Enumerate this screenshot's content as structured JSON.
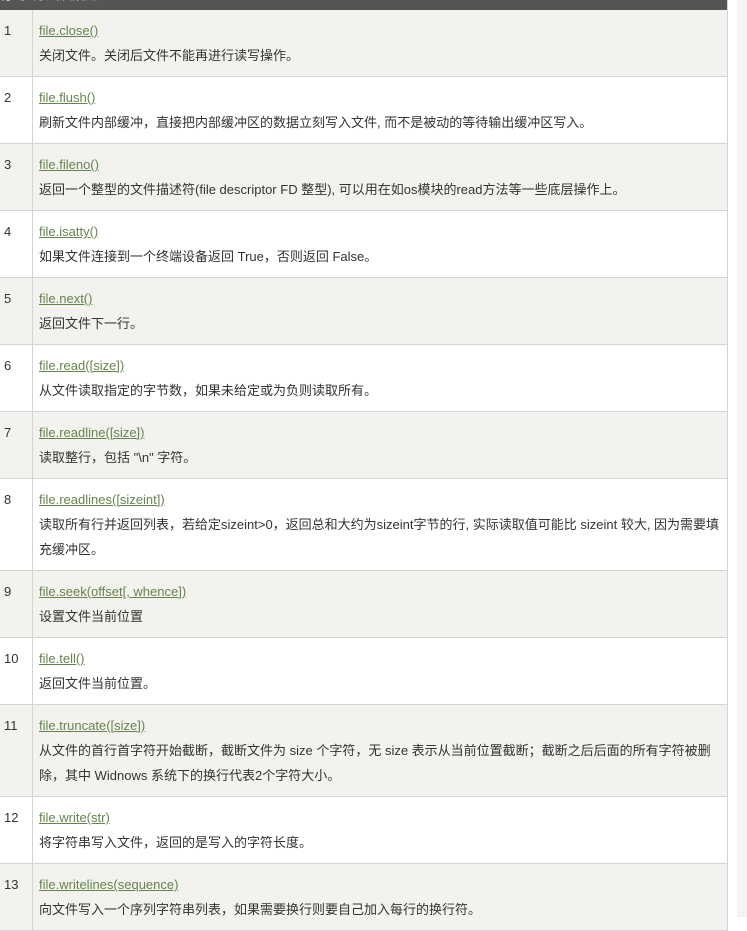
{
  "header": {
    "col_num": "序号",
    "col_desc": "方法及描述"
  },
  "rows": [
    {
      "num": "1",
      "method": "file.close()",
      "desc": "关闭文件。关闭后文件不能再进行读写操作。"
    },
    {
      "num": "2",
      "method": "file.flush()",
      "desc": "刷新文件内部缓冲，直接把内部缓冲区的数据立刻写入文件, 而不是被动的等待输出缓冲区写入。"
    },
    {
      "num": "3",
      "method": "file.fileno()",
      "desc": "返回一个整型的文件描述符(file descriptor FD 整型), 可以用在如os模块的read方法等一些底层操作上。"
    },
    {
      "num": "4",
      "method": "file.isatty()",
      "desc": "如果文件连接到一个终端设备返回 True，否则返回 False。"
    },
    {
      "num": "5",
      "method": "file.next()",
      "desc": "返回文件下一行。"
    },
    {
      "num": "6",
      "method": "file.read([size])",
      "desc": "从文件读取指定的字节数，如果未给定或为负则读取所有。"
    },
    {
      "num": "7",
      "method": "file.readline([size])",
      "desc": "读取整行，包括 \"\\n\" 字符。"
    },
    {
      "num": "8",
      "method": "file.readlines([sizeint])",
      "desc": "读取所有行并返回列表，若给定sizeint>0，返回总和大约为sizeint字节的行, 实际读取值可能比 sizeint 较大, 因为需要填充缓冲区。"
    },
    {
      "num": "9",
      "method": "file.seek(offset[, whence])",
      "desc": "设置文件当前位置"
    },
    {
      "num": "10",
      "method": "file.tell()",
      "desc": "返回文件当前位置。"
    },
    {
      "num": "11",
      "method": "file.truncate([size])",
      "desc": "从文件的首行首字符开始截断，截断文件为 size 个字符，无 size 表示从当前位置截断；截断之后后面的所有字符被删除，其中 Widnows 系统下的换行代表2个字符大小。"
    },
    {
      "num": "12",
      "method": "file.write(str)",
      "desc": "将字符串写入文件，返回的是写入的字符长度。"
    },
    {
      "num": "13",
      "method": "file.writelines(sequence)",
      "desc": "向文件写入一个序列字符串列表，如果需要换行则要自己加入每行的换行符。"
    }
  ]
}
